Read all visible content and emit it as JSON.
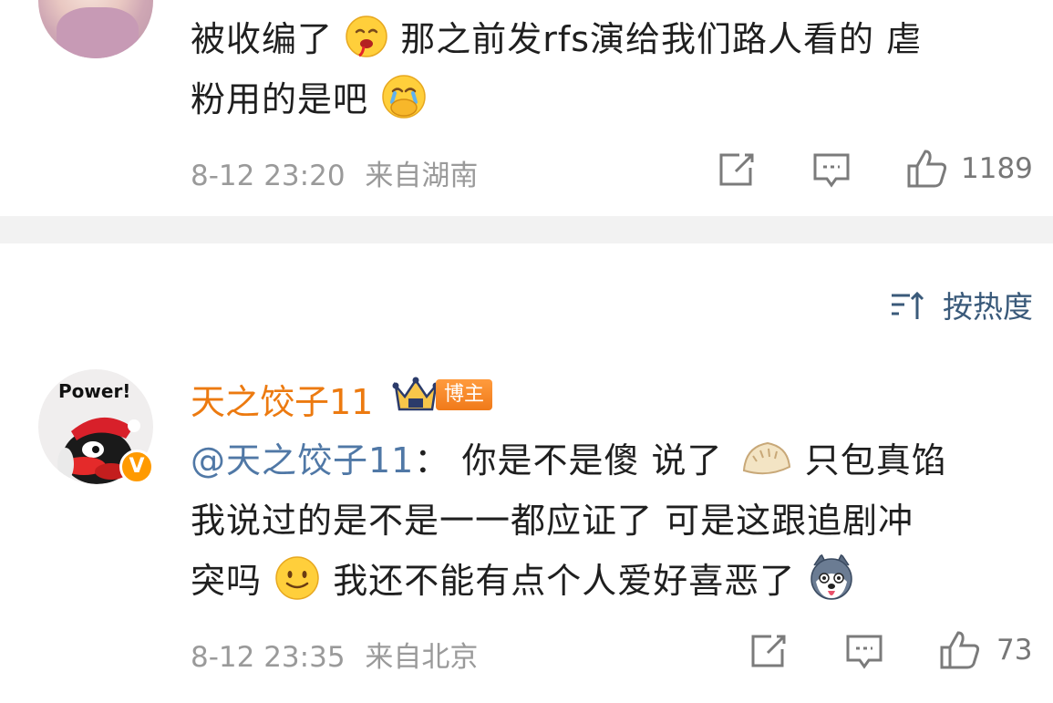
{
  "comment1": {
    "line1": "被收编了",
    "line1_after_emoji": "那之前发rfs演给我们路人看的 虐",
    "line2": "粉用的是吧",
    "timestamp": "8-12 23:20",
    "location": "来自湖南",
    "like_count": "1189"
  },
  "sort": {
    "label": "按热度"
  },
  "comment2": {
    "username": "天之饺子11",
    "badge_label": "博主",
    "verified_mark": "V",
    "mention": "@天之饺子11",
    "colon": "：",
    "line1": "你是不是傻 说了",
    "line1_after_emoji": "只包真馅",
    "line2": "我说过的是不是一一都应证了 可是这跟追剧冲",
    "line3": "突吗",
    "line3_after_emoji": "我还不能有点个人爱好喜恶了",
    "timestamp": "8-12 23:35",
    "location": "来自北京",
    "like_count": "73",
    "avatar_text": "Power!"
  },
  "colors": {
    "username": "#ec7a10",
    "mention": "#5078a6",
    "meta": "#9a9a9a",
    "divider": "#f2f2f2",
    "sort": "#3a5a7a"
  },
  "icons": [
    "share-icon",
    "comment-icon",
    "like-icon",
    "sort-icon"
  ]
}
